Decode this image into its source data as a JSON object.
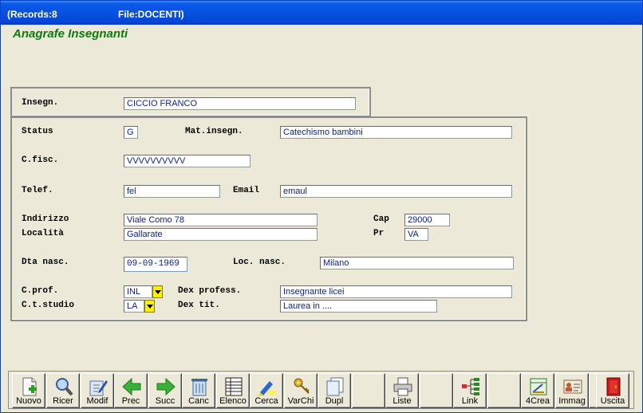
{
  "titlebar": {
    "records": "(Records:8",
    "file": "File:DOCENTI)"
  },
  "form_title": "Anagrafe Insegnanti",
  "fields": {
    "insegnante": {
      "label": "Insegn.",
      "value": "CICCIO FRANCO"
    },
    "status": {
      "label": "Status",
      "value": "G"
    },
    "materia": {
      "label": "Mat.insegn.",
      "value": "Catechismo bambini"
    },
    "codice_fiscale": {
      "label": "C.fisc.",
      "value": "VVVVVVVVVV"
    },
    "telefono": {
      "label": "Telef.",
      "value": "fel"
    },
    "email": {
      "label": "Email",
      "value": "emaul"
    },
    "indirizzo": {
      "label": "Indirizzo",
      "value": "Viale Como 78"
    },
    "cap": {
      "label": "Cap",
      "value": "29000"
    },
    "localita": {
      "label": "Località",
      "value": "Gallarate"
    },
    "provincia": {
      "label": "Pr",
      "value": "VA"
    },
    "data_nascita": {
      "label": "Dta nasc.",
      "value": "09-09-1969"
    },
    "luogo_nascita": {
      "label": "Loc. nasc.",
      "value": "Milano"
    },
    "codice_professione": {
      "label": "C.prof.",
      "value": "INL"
    },
    "descr_professione": {
      "label": "Dex profess.",
      "value": "Insegnante licei"
    },
    "codice_titolo_studio": {
      "label": "C.t.studio",
      "value": "LA"
    },
    "descr_titolo": {
      "label": "Dex tit.",
      "value": "Laurea in ...."
    }
  },
  "toolbar": [
    {
      "label": "Nuovo",
      "icon": "new-icon"
    },
    {
      "label": "Ricer",
      "icon": "search-icon"
    },
    {
      "label": "Modif",
      "icon": "edit-icon"
    },
    {
      "label": "Prec",
      "icon": "arrow-left-icon"
    },
    {
      "label": "Succ",
      "icon": "arrow-right-icon"
    },
    {
      "label": "Canc",
      "icon": "trash-icon"
    },
    {
      "label": "Elenco",
      "icon": "list-icon"
    },
    {
      "label": "Cerca",
      "icon": "highlighter-icon"
    },
    {
      "label": "VarChi",
      "icon": "keys-icon"
    },
    {
      "label": "Dupl",
      "icon": "duplicate-icon"
    },
    {
      "label": "",
      "icon": ""
    },
    {
      "label": "Liste",
      "icon": "printer-icon"
    },
    {
      "label": "",
      "icon": ""
    },
    {
      "label": "Link",
      "icon": "tree-icon"
    },
    {
      "label": "",
      "icon": ""
    },
    {
      "label": "4Crea",
      "icon": "design-icon"
    },
    {
      "label": "Immag",
      "icon": "id-card-icon"
    },
    {
      "label": "",
      "icon": ""
    },
    {
      "label": "Uscita",
      "icon": "exit-door-icon"
    }
  ],
  "colors": {
    "title_green": "#0e7a13",
    "field_text": "#0b1f8a",
    "dropdown": "#ffef00",
    "titlebar": "#0852e0"
  }
}
